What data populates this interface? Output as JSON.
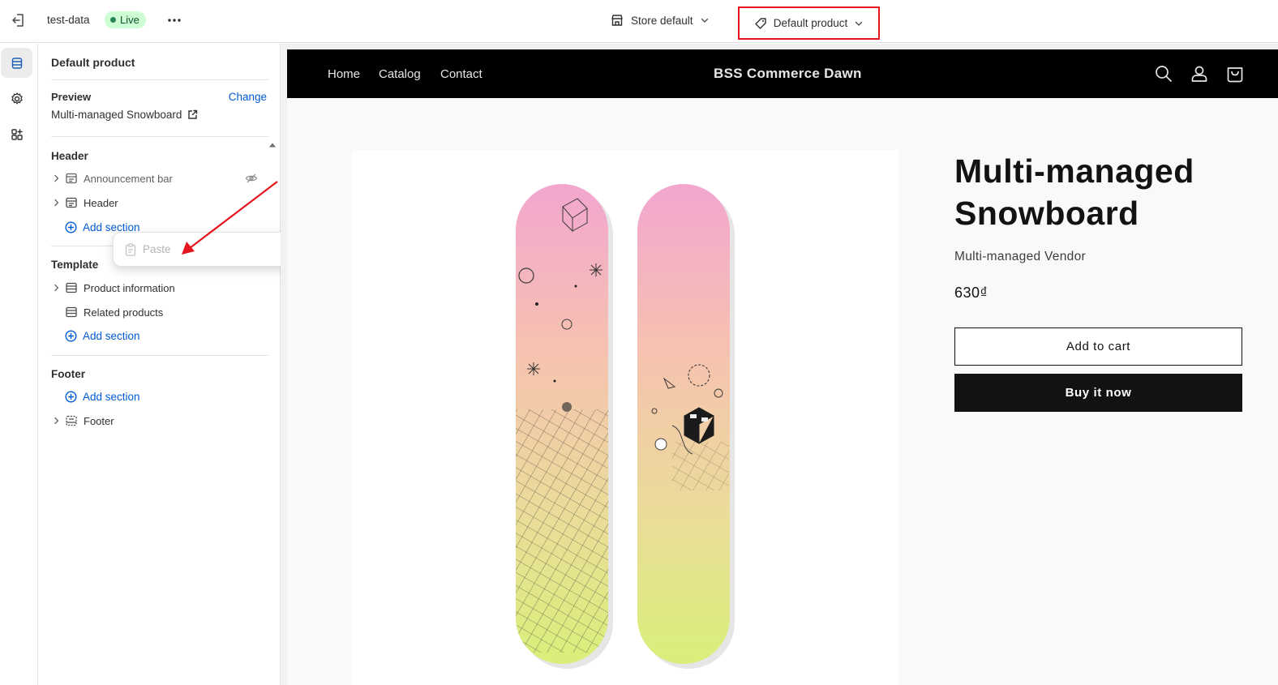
{
  "topbar": {
    "theme_name": "test-data",
    "status_badge": "Live",
    "store_selector": "Store default",
    "template_selector": "Default product"
  },
  "rail": {
    "items": [
      {
        "icon": "sections-icon",
        "active": true
      },
      {
        "icon": "gear-icon",
        "active": false
      },
      {
        "icon": "apps-icon",
        "active": false
      }
    ]
  },
  "sidebar": {
    "title": "Default product",
    "preview": {
      "label": "Preview",
      "change_label": "Change",
      "value": "Multi-managed Snowboard"
    },
    "groups": {
      "header": {
        "title": "Header",
        "sections": [
          "Announcement bar",
          "Header"
        ],
        "add_label": "Add section"
      },
      "template": {
        "title": "Template",
        "sections": [
          "Product information",
          "Related products"
        ],
        "add_label": "Add section"
      },
      "footer": {
        "title": "Footer",
        "add_label": "Add section",
        "sections": [
          "Footer"
        ]
      }
    },
    "context_menu": {
      "paste_label": "Paste"
    }
  },
  "preview": {
    "nav": [
      "Home",
      "Catalog",
      "Contact"
    ],
    "store_title": "BSS Commerce Dawn",
    "product": {
      "title": "Multi-managed Snowboard",
      "vendor": "Multi-managed Vendor",
      "price": "630₫",
      "add_to_cart": "Add to cart",
      "buy_now": "Buy it now"
    }
  },
  "colors": {
    "link_blue": "#005bd3",
    "live_green": "#cdfed4",
    "highlight_red": "#e3161f",
    "shop_header": "#000000"
  }
}
